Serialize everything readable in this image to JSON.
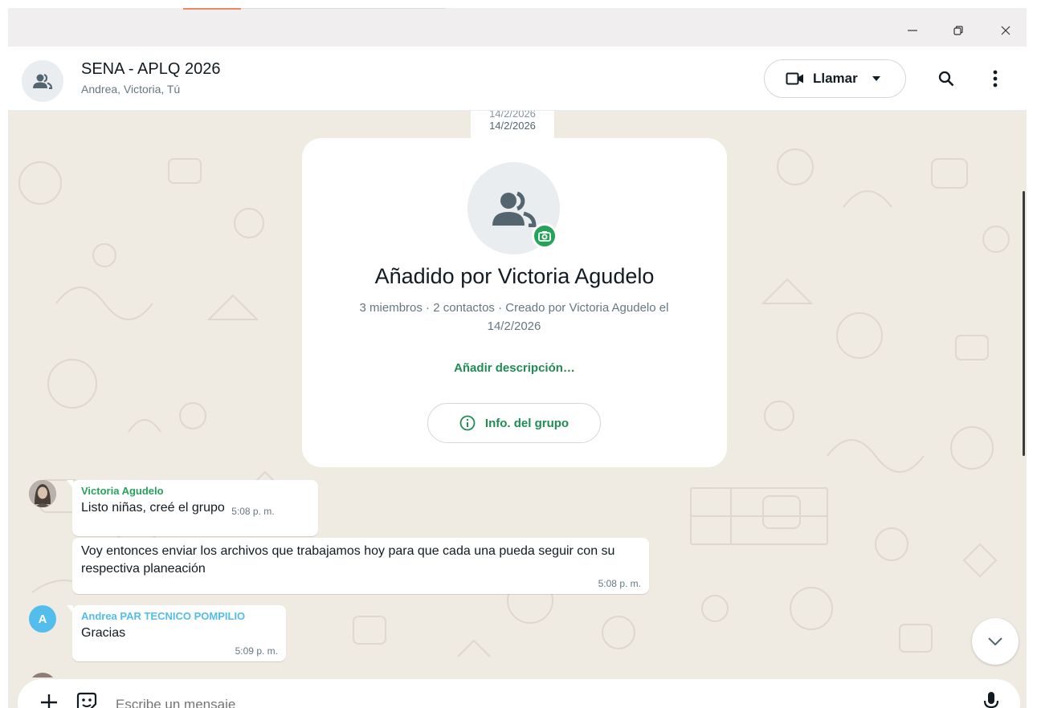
{
  "window": {
    "minimize_icon": "minimize-icon",
    "restore_icon": "restore-icon",
    "close_icon": "close-icon"
  },
  "header": {
    "title": "SENA - APLQ 2026",
    "subtitle": "Andrea, Victoria, Tú",
    "call_label": "Llamar",
    "icons": [
      "group-avatar-icon",
      "video-call-icon",
      "chevron-down-icon",
      "search-icon",
      "more-vert-icon"
    ]
  },
  "chat": {
    "date_ghost": "14/2/2026",
    "date": "14/2/2026",
    "group_card": {
      "title": "Añadido por Victoria Agudelo",
      "meta": "3 miembros · 2 contactos · Creado por Victoria Agudelo el 14/2/2026",
      "add_description": "Añadir descripción…",
      "info_button": "Info. del grupo"
    },
    "messages": [
      {
        "sender": "Victoria Agudelo",
        "sender_color": "#25a35a",
        "text": "Listo niñas, creé el grupo",
        "time": "5:08 p. m."
      },
      {
        "sender": "",
        "text": "Voy entonces enviar los archivos que trabajamos hoy para que cada una pueda seguir con su respectiva planeación",
        "time": "5:08 p. m."
      },
      {
        "sender": "Andrea PAR TECNICO POMPILIO",
        "sender_color": "#53bdeb",
        "avatar_letter": "A",
        "text": "Gracias",
        "time": "5:09 p. m."
      }
    ]
  },
  "composer": {
    "placeholder": "Escribe un mensaje",
    "icons": [
      "plus-icon",
      "sticker-icon",
      "mic-icon"
    ]
  },
  "colors": {
    "accent_green": "#1f8c53",
    "chat_bg": "#efeae2",
    "avatar_blue": "#53bdeb"
  }
}
